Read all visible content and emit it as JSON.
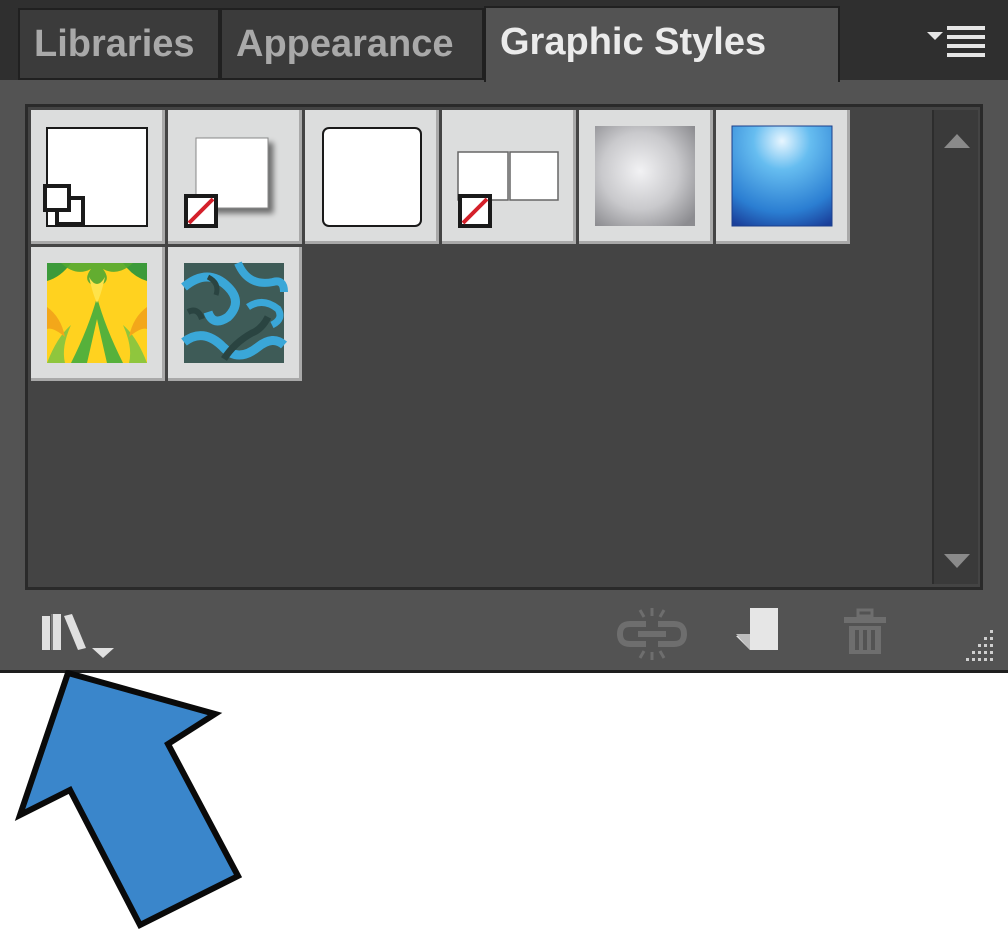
{
  "tabs": [
    {
      "label": "Libraries",
      "active": false
    },
    {
      "label": "Appearance",
      "active": false
    },
    {
      "label": "Graphic Styles",
      "active": true
    }
  ],
  "panel_menu_icon": "panel-menu-icon",
  "swatches": [
    {
      "name": "default-graphic-style",
      "kind": "default"
    },
    {
      "name": "drop-shadow-style",
      "kind": "shadow"
    },
    {
      "name": "round-corners-style",
      "kind": "rounded"
    },
    {
      "name": "double-box-style",
      "kind": "double"
    },
    {
      "name": "gray-bevel-style",
      "kind": "gray-gradient"
    },
    {
      "name": "blue-gradient-style",
      "kind": "blue-gradient"
    },
    {
      "name": "yellow-green-pattern-style",
      "kind": "yellow-pattern"
    },
    {
      "name": "teal-swirl-pattern-style",
      "kind": "teal-pattern"
    }
  ],
  "bottom_icons": [
    "graphic-styles-library-menu-icon",
    "break-link-icon",
    "new-graphic-style-icon",
    "delete-graphic-style-icon",
    "resize-grip-icon"
  ],
  "colors": {
    "panel_bg": "#535353",
    "swatch_area_bg": "#444444",
    "tab_active_text": "#ebebeb",
    "tab_inactive_text": "#a9a9a9",
    "callout_arrow": "#3a86cb"
  }
}
